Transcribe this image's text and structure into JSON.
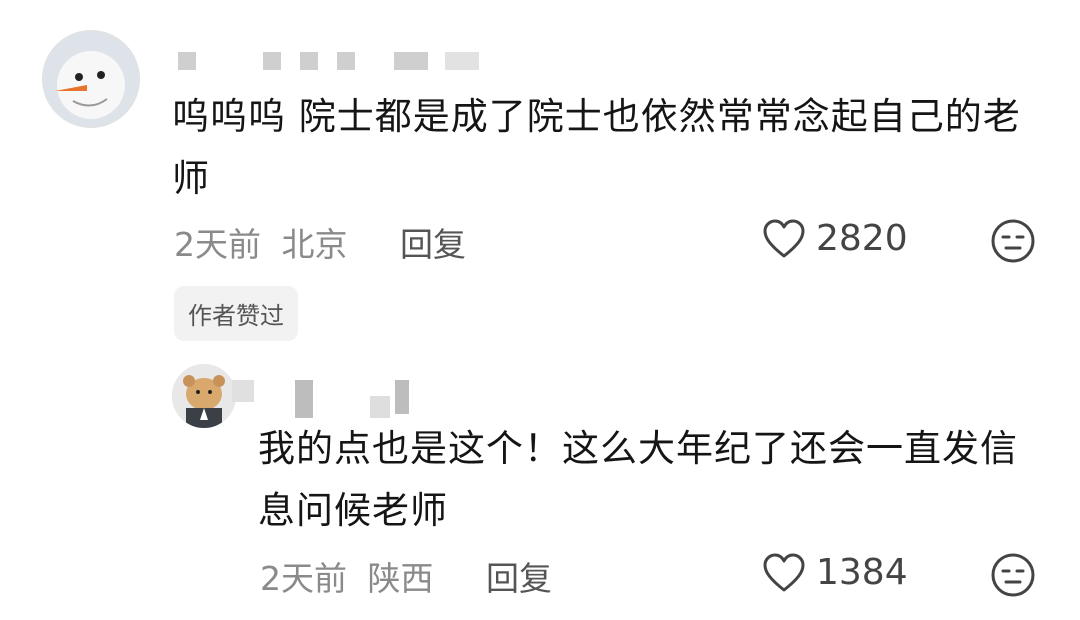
{
  "comments": [
    {
      "text": "呜呜呜 院士都是成了院士也依然常常念起自己的老师",
      "time": "2天前",
      "location": "北京",
      "reply_label": "回复",
      "likes": "2820",
      "badge": "作者赞过"
    },
    {
      "text": "我的点也是这个！这么大年纪了还会一直发信息问候老师",
      "time": "2天前",
      "location": "陕西",
      "reply_label": "回复",
      "likes": "1384"
    }
  ]
}
